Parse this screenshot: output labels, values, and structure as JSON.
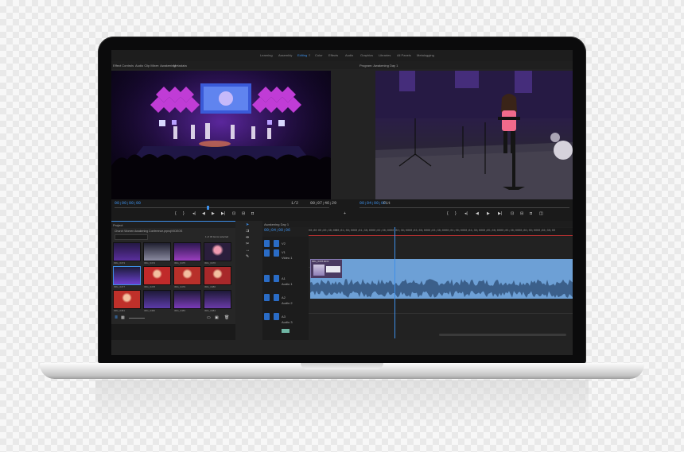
{
  "app": {
    "workspaces": [
      {
        "label": "Learning"
      },
      {
        "label": "Assembly"
      },
      {
        "label": "Editing"
      },
      {
        "label": "Color"
      },
      {
        "label": "Effects"
      },
      {
        "label": "Audio"
      },
      {
        "label": "Graphics"
      },
      {
        "label": "Libraries"
      },
      {
        "label": "All Panels"
      },
      {
        "label": "Metalogging"
      }
    ],
    "active_workspace": "Editing",
    "accent_color": "#3d8fe8"
  },
  "source_panel": {
    "tabs": [
      "Effect Controls",
      "Audio Clip Mixer: Awakening",
      "Metadata"
    ],
    "timecode_left": "00;00;00;00",
    "timecode_right": "00;07;46;29",
    "zoom": "1/2"
  },
  "program_panel": {
    "title": "Program: Awakening Day 1",
    "timecode": "00;04;00;00",
    "zoom": "Fit"
  },
  "project_panel": {
    "title": "Project",
    "path": "Church Women Awakening Conference.prproj\\VIDEOS",
    "items_selected": "1 of 33 items selected",
    "clips": [
      {
        "label": "IMG_0473"
      },
      {
        "label": "IMG_0474"
      },
      {
        "label": "IMG_0475"
      },
      {
        "label": "IMG_0476"
      },
      {
        "label": "IMG_0477"
      },
      {
        "label": "IMG_0478"
      },
      {
        "label": "IMG_0479"
      },
      {
        "label": "IMG_0480"
      },
      {
        "label": "IMG_0481"
      },
      {
        "label": "IMG_0482"
      },
      {
        "label": "IMG_0483"
      },
      {
        "label": "IMG_0484"
      }
    ]
  },
  "timeline": {
    "sequence_tab": "Awakening Day 1",
    "timecode": "00;04;00;06",
    "ruler": [
      "00;00",
      "00;00;30;00",
      "00;01;00;00",
      "00;01;30;00",
      "00;02;00;00",
      "00;02;30;00",
      "00;03;00;00",
      "00;03;30;00",
      "00;04;00;00",
      "00;04;30;00",
      "00;05;00;00",
      "00;05;30;00",
      "00;06;00;00",
      "00;06;30;00"
    ],
    "tracks": [
      {
        "id": "V2",
        "label": ""
      },
      {
        "id": "V1",
        "label": "Video 1"
      },
      {
        "id": "A1",
        "label": "Audio 1"
      },
      {
        "id": "A2",
        "label": "Audio 2"
      },
      {
        "id": "A3",
        "label": "Audio 3"
      }
    ],
    "clip_label": "IMG_0478.MOV"
  }
}
